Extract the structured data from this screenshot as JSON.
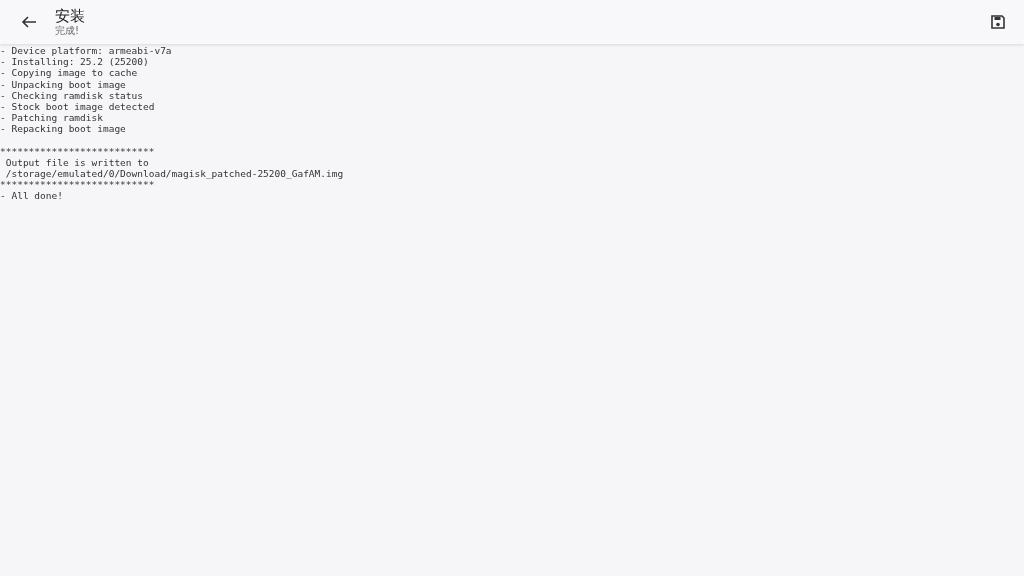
{
  "app_bar": {
    "title": "安装",
    "subtitle": "完成!"
  },
  "log": {
    "sections": [
      {
        "lines": [
          "- Device platform: armeabi-v7a",
          "- Installing: 25.2 (25200)",
          "- Copying image to cache",
          "- Unpacking boot image",
          "- Checking ramdisk status",
          "- Stock boot image detected",
          "- Patching ramdisk",
          "- Repacking boot image"
        ]
      },
      {
        "lines": [
          "***************************",
          " Output file is written to",
          " /storage/emulated/0/Download/magisk_patched-25200_GafAM.img",
          "***************************",
          "- All done!"
        ]
      }
    ]
  }
}
